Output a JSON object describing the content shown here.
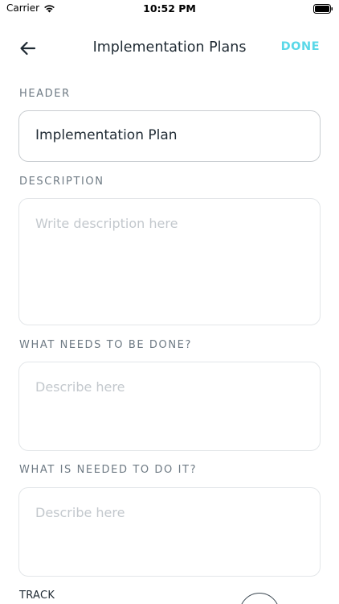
{
  "status_bar": {
    "carrier": "Carrier",
    "time": "10:52 PM",
    "icons": [
      "wifi-icon",
      "battery-icon"
    ]
  },
  "nav": {
    "back_icon": "arrow-left-icon",
    "title": "Implementation Plans",
    "done_label": "DONE",
    "accent_color": "#5ad8e8"
  },
  "form": {
    "header": {
      "label": "HEADER",
      "value": "Implementation Plan"
    },
    "description": {
      "label": "DESCRIPTION",
      "placeholder": "Write description here"
    },
    "what_needs": {
      "label": "WHAT NEEDS TO BE DONE?",
      "placeholder": "Describe here"
    },
    "what_is_needed": {
      "label": "WHAT IS NEEDED TO DO IT?",
      "placeholder": "Describe here"
    },
    "track": {
      "label": "TRACK"
    }
  }
}
